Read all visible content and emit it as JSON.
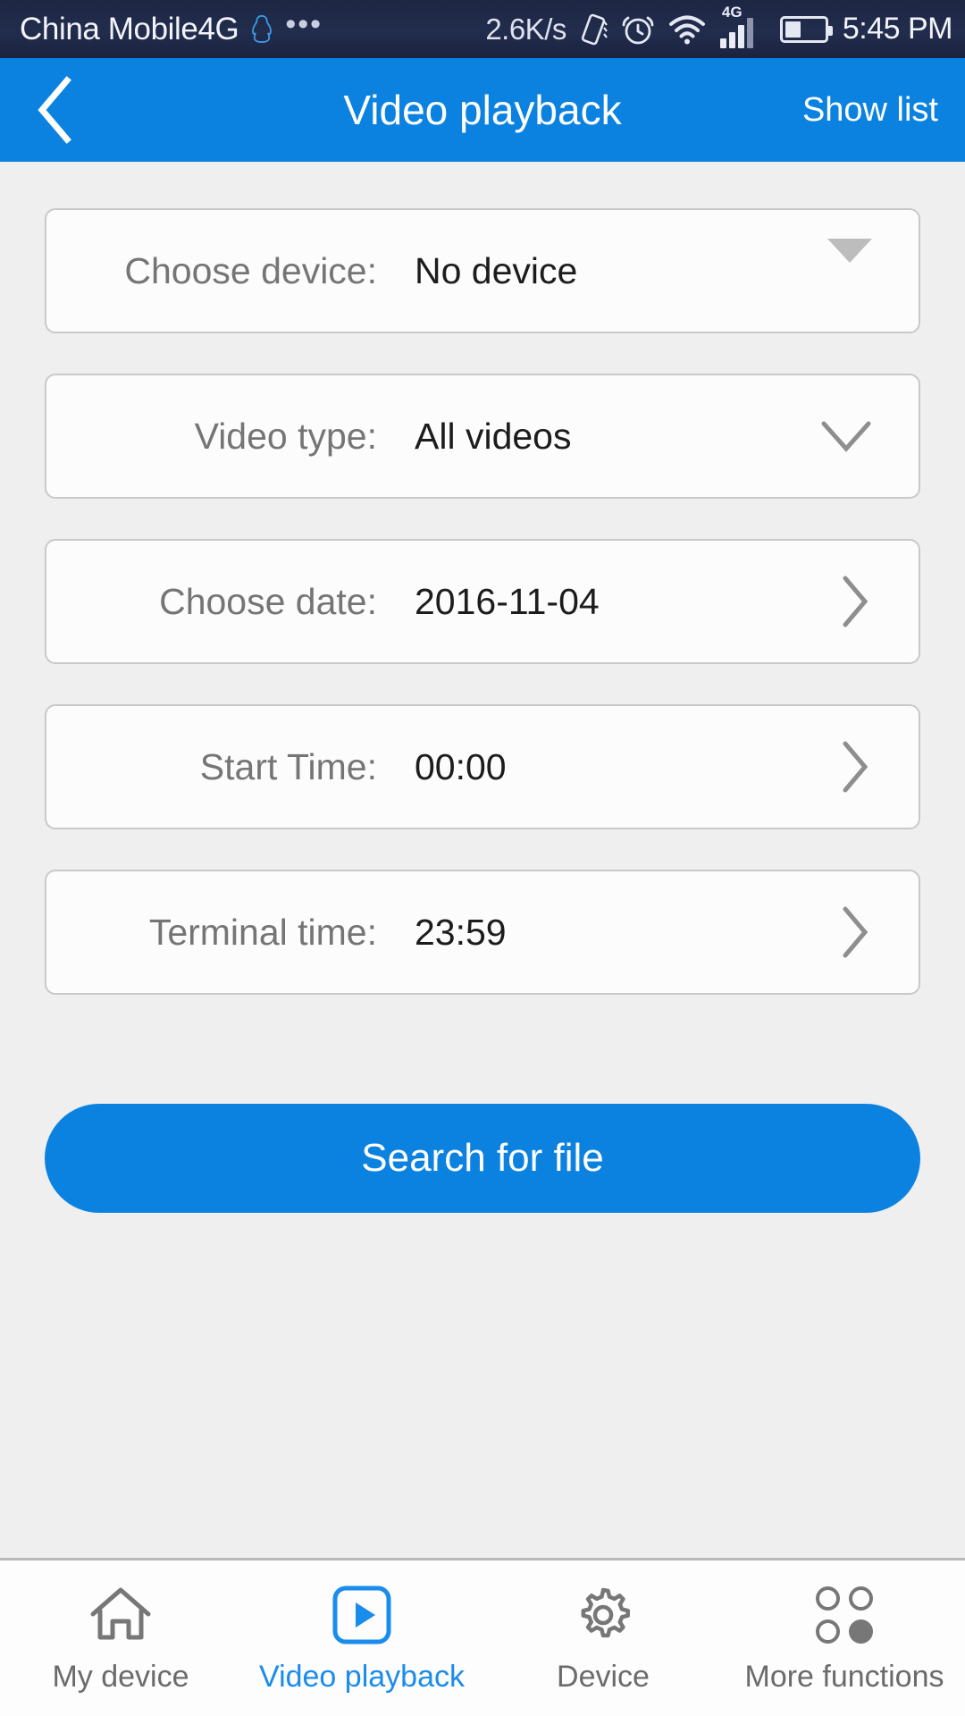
{
  "status_bar": {
    "carrier": "China Mobile4G",
    "qq_icon": "qq-penguin-icon",
    "overflow_icon": "more-dots-icon",
    "network_speed": "2.6K/s",
    "vibrate_icon": "vibrate-icon",
    "alarm_icon": "alarm-clock-icon",
    "wifi_icon": "wifi-icon",
    "signal_label": "4G",
    "signal_bars_filled": 3,
    "signal_bars_total": 4,
    "battery_icon": "battery-icon",
    "battery_level_percent": 40,
    "time": "5:45 PM"
  },
  "header": {
    "back_icon": "chevron-left-icon",
    "title": "Video playback",
    "action_label": "Show list",
    "background_color": "#0b82e0"
  },
  "form": {
    "rows": [
      {
        "label": "Choose device:",
        "value": "No device",
        "indicator": "triangle-down-icon",
        "name": "choose-device"
      },
      {
        "label": "Video type:",
        "value": "All videos",
        "indicator": "chevron-down-icon",
        "name": "video-type"
      },
      {
        "label": "Choose date:",
        "value": "2016-11-04",
        "indicator": "chevron-right-icon",
        "name": "choose-date"
      },
      {
        "label": "Start Time:",
        "value": "00:00",
        "indicator": "chevron-right-icon",
        "name": "start-time"
      },
      {
        "label": "Terminal time:",
        "value": "23:59",
        "indicator": "chevron-right-icon",
        "name": "terminal-time"
      }
    ]
  },
  "search_button": {
    "label": "Search for file",
    "color": "#0b82e0"
  },
  "bottom_nav": {
    "active_color": "#1a8cec",
    "inactive_color": "#6b6b6b",
    "items": [
      {
        "label": "My device",
        "icon": "home-icon",
        "active": false
      },
      {
        "label": "Video playback",
        "icon": "play-square-icon",
        "active": true
      },
      {
        "label": "Device",
        "icon": "gear-icon",
        "active": false
      },
      {
        "label": "More functions",
        "icon": "grid-dots-icon",
        "active": false
      }
    ]
  }
}
